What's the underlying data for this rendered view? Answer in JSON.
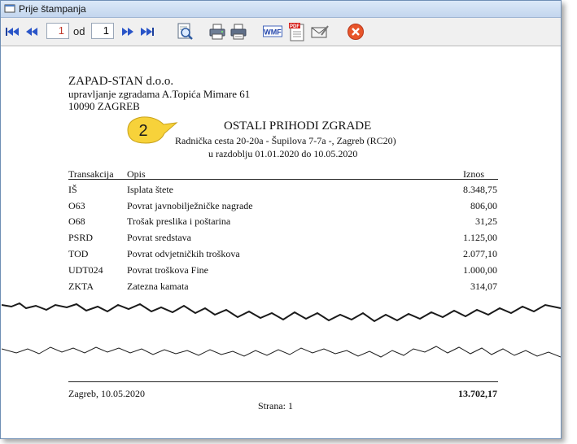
{
  "window": {
    "title": "Prije štampanja"
  },
  "toolbar": {
    "current_page": "1",
    "of_label": "od",
    "total_pages": "1",
    "icons": [
      "first-page-icon",
      "previous-page-icon",
      "next-page-icon",
      "last-page-icon",
      "zoom-icon",
      "print-setup-icon",
      "print-icon",
      "wmf-export-icon",
      "pdf-export-icon",
      "email-icon",
      "close-icon"
    ],
    "wmf_label": "WMF",
    "pdf_label": "PDF"
  },
  "report": {
    "company": "ZAPAD-STAN d.o.o.",
    "company_line2": "upravljanje zgradama A.Topića Mimare 61",
    "company_line3": "10090 ZAGREB",
    "title": "OSTALI PRIHODI ZGRADE",
    "subtitle": "Radnička cesta 20-20a - Šupilova 7-7a -, Zagreb (RC20)",
    "period": "u razdoblju 01.01.2020 do 10.05.2020",
    "columns": {
      "transakcija": "Transakcija",
      "opis": "Opis",
      "iznos": "Iznos"
    },
    "rows": [
      {
        "code": "IŠ",
        "desc": "Isplata štete",
        "amount": "8.348,75"
      },
      {
        "code": "O63",
        "desc": "Povrat javnobilježničke nagrade",
        "amount": "806,00"
      },
      {
        "code": "O68",
        "desc": "Trošak preslika i poštarina",
        "amount": "31,25"
      },
      {
        "code": "PSRD",
        "desc": "Povrat sredstava",
        "amount": "1.125,00"
      },
      {
        "code": "TOD",
        "desc": "Povrat odvjetničkih troškova",
        "amount": "2.077,10"
      },
      {
        "code": "UDT024",
        "desc": "Povrat troškova  Fine",
        "amount": "1.000,00"
      },
      {
        "code": "ZKTA",
        "desc": "Zatezna kamata",
        "amount": "314,07"
      }
    ],
    "footer_place_date": "Zagreb, 10.05.2020",
    "total": "13.702,17",
    "page_label": "Strana:  1"
  },
  "callout": {
    "number": "2",
    "color": "#f7d23a"
  },
  "colors": {
    "close_button": "#e8552a",
    "title_bar": "#c9daf0"
  }
}
